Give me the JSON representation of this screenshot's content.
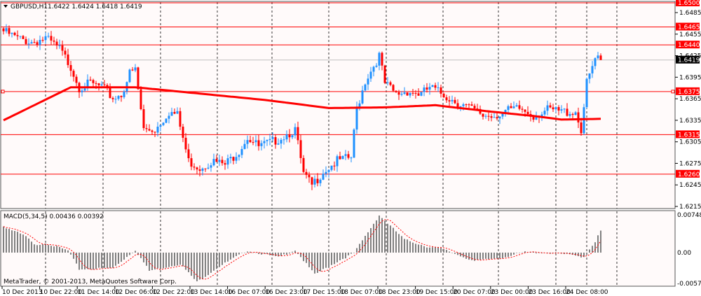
{
  "header": {
    "symbol": "GBPUSD,H1",
    "ohlc": "1.6422 1.6424 1.6418 1.6419"
  },
  "macd_header": "MACD(5,34,5) 0.00436 0.00392",
  "copyright": "MetaTrader, © 2001-2013, MetaQuotes Software Corp.",
  "colors": {
    "bull": "#1e90ff",
    "bear": "#ff0000",
    "ma": "#ff0000",
    "level": "#ff0000",
    "bg": "#fffafa",
    "macd_hist": "#808080",
    "signal": "#ff0000"
  },
  "chart_data": [
    {
      "type": "candlestick",
      "title": "GBPUSD,H1",
      "ylim": [
        1.6215,
        1.65
      ],
      "price_ticks": [
        "1.6485",
        "1.6455",
        "1.6425",
        "1.6395",
        "1.6365",
        "1.6335",
        "1.6305",
        "1.6275",
        "1.6245",
        "1.6215"
      ],
      "levels": [
        {
          "label": "1.6500",
          "value": 1.65
        },
        {
          "label": "1.6465",
          "value": 1.6465
        },
        {
          "label": "1.6440",
          "value": 1.644
        },
        {
          "label": "1.6375",
          "value": 1.6375
        },
        {
          "label": "1.6315",
          "value": 1.6315
        },
        {
          "label": "1.6260",
          "value": 1.626
        }
      ],
      "current_price": {
        "label": "1.6419",
        "value": 1.6419
      },
      "bars": 214,
      "close_path": [
        [
          0,
          1.6459
        ],
        [
          5,
          1.6449
        ],
        [
          10,
          1.6444
        ],
        [
          15,
          1.6449
        ],
        [
          20,
          1.6434
        ],
        [
          24,
          1.641
        ],
        [
          27,
          1.6381
        ],
        [
          31,
          1.6386
        ],
        [
          35,
          1.6381
        ],
        [
          39,
          1.6366
        ],
        [
          42,
          1.6371
        ],
        [
          45,
          1.64
        ],
        [
          47,
          1.6405
        ],
        [
          50,
          1.6322
        ],
        [
          54,
          1.6322
        ],
        [
          59,
          1.6347
        ],
        [
          62,
          1.6342
        ],
        [
          66,
          1.6278
        ],
        [
          70,
          1.6269
        ],
        [
          74,
          1.6278
        ],
        [
          79,
          1.6273
        ],
        [
          84,
          1.6293
        ],
        [
          87,
          1.6312
        ],
        [
          91,
          1.6298
        ],
        [
          96,
          1.6305
        ],
        [
          104,
          1.6322
        ],
        [
          107,
          1.6259
        ],
        [
          110,
          1.6244
        ],
        [
          114,
          1.6264
        ],
        [
          119,
          1.6278
        ],
        [
          124,
          1.6283
        ],
        [
          126,
          1.6351
        ],
        [
          129,
          1.639
        ],
        [
          134,
          1.6425
        ],
        [
          136,
          1.6386
        ],
        [
          140,
          1.6371
        ],
        [
          144,
          1.6376
        ],
        [
          149,
          1.6371
        ],
        [
          152,
          1.6381
        ],
        [
          159,
          1.6366
        ],
        [
          164,
          1.6356
        ],
        [
          171,
          1.6342
        ],
        [
          175,
          1.6342
        ],
        [
          179,
          1.6347
        ],
        [
          184,
          1.6351
        ],
        [
          189,
          1.6342
        ],
        [
          194,
          1.6349
        ],
        [
          199,
          1.6347
        ],
        [
          204,
          1.6347
        ],
        [
          206,
          1.6322
        ],
        [
          208,
          1.6386
        ],
        [
          211,
          1.642
        ],
        [
          213,
          1.6419
        ]
      ],
      "moving_average": [
        [
          0,
          1.6335
        ],
        [
          24,
          1.6381
        ],
        [
          47,
          1.6381
        ],
        [
          94,
          1.6363
        ],
        [
          116,
          1.6352
        ],
        [
          136,
          1.6353
        ],
        [
          154,
          1.6356
        ],
        [
          174,
          1.6347
        ],
        [
          189,
          1.6341
        ],
        [
          199,
          1.6336
        ],
        [
          213,
          1.6337
        ]
      ],
      "time_labels": [
        "10 Dec 2013",
        "10 Dec 22:00",
        "11 Dec 14:00",
        "12 Dec 06:00",
        "12 Dec 22:00",
        "13 Dec 14:00",
        "16 Dec 07:00",
        "16 Dec 23:00",
        "17 Dec 15:00",
        "18 Dec 07:00",
        "18 Dec 23:00",
        "19 Dec 15:00",
        "20 Dec 07:00",
        "23 Dec 00:00",
        "23 Dec 16:00",
        "24 Dec 08:00"
      ]
    },
    {
      "type": "bar",
      "title": "MACD(5,34,5)",
      "ylim": [
        -0.00575,
        0.00748
      ],
      "ticks": [
        "0.00748",
        "0.00",
        "-0.00575"
      ],
      "histogram_path": [
        [
          0,
          0.0052
        ],
        [
          8,
          0.0032
        ],
        [
          11,
          0.0015
        ],
        [
          15,
          0.0019
        ],
        [
          23,
          0.0004
        ],
        [
          27,
          -0.0031
        ],
        [
          39,
          -0.0029
        ],
        [
          47,
          0.0005
        ],
        [
          52,
          -0.0034
        ],
        [
          63,
          -0.0021
        ],
        [
          69,
          -0.0055
        ],
        [
          76,
          -0.0029
        ],
        [
          87,
          0.0004
        ],
        [
          98,
          -0.0009
        ],
        [
          104,
          0.0005
        ],
        [
          111,
          -0.0041
        ],
        [
          120,
          -0.0014
        ],
        [
          125,
          -0.0001
        ],
        [
          134,
          0.0074
        ],
        [
          143,
          0.0026
        ],
        [
          151,
          0.0012
        ],
        [
          156,
          0.0008
        ],
        [
          168,
          -0.0016
        ],
        [
          178,
          -0.0009
        ],
        [
          186,
          0.0001
        ],
        [
          197,
          -0.0001
        ],
        [
          207,
          -0.0008
        ],
        [
          211,
          0.0022
        ],
        [
          213,
          0.00436
        ]
      ],
      "signal_last": 0.00392
    }
  ]
}
